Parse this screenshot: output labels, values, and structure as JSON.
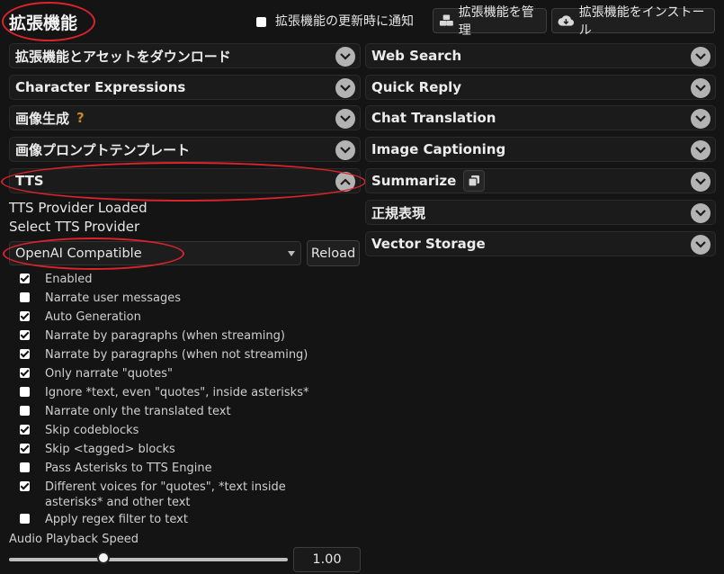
{
  "header": {
    "title": "拡張機能",
    "notify_label": "拡張機能の更新時に通知",
    "notify_checked": false,
    "manage_label": "拡張機能を管理",
    "install_label": "拡張機能をインストール"
  },
  "left_drawers": [
    {
      "label": "拡張機能とアセットをダウンロード"
    },
    {
      "label": "Character Expressions"
    },
    {
      "label": "画像生成",
      "help": "?"
    },
    {
      "label": "画像プロンプトテンプレート"
    },
    {
      "label": "TTS",
      "expanded": true
    }
  ],
  "right_drawers": [
    {
      "label": "Web Search"
    },
    {
      "label": "Quick Reply"
    },
    {
      "label": "Chat Translation"
    },
    {
      "label": "Image Captioning"
    },
    {
      "label": "Summarize"
    },
    {
      "label": "正規表現"
    },
    {
      "label": "Vector Storage"
    }
  ],
  "tts": {
    "status": "TTS Provider Loaded",
    "select_label": "Select TTS Provider",
    "provider": "OpenAI Compatible",
    "reload_label": "Reload",
    "options": [
      {
        "label": "Enabled",
        "checked": true
      },
      {
        "label": "Narrate user messages",
        "checked": false
      },
      {
        "label": "Auto Generation",
        "checked": true
      },
      {
        "label": "Narrate by paragraphs (when streaming)",
        "checked": true
      },
      {
        "label": "Narrate by paragraphs (when not streaming)",
        "checked": true
      },
      {
        "label": "Only narrate \"quotes\"",
        "checked": true
      },
      {
        "label": "Ignore *text, even \"quotes\", inside asterisks*",
        "checked": false
      },
      {
        "label": "Narrate only the translated text",
        "checked": false
      },
      {
        "label": "Skip codeblocks",
        "checked": true
      },
      {
        "label": "Skip <tagged> blocks",
        "checked": true
      },
      {
        "label": "Pass Asterisks to TTS Engine",
        "checked": false
      },
      {
        "label": "Different voices for \"quotes\", *text inside asterisks* and other text",
        "checked": true
      },
      {
        "label": "Apply regex filter to text",
        "checked": false
      }
    ],
    "speed_label": "Audio Playback Speed",
    "speed_value": "1.00"
  },
  "colors": {
    "annotation": "#d9242b",
    "help": "#c08a2a"
  }
}
